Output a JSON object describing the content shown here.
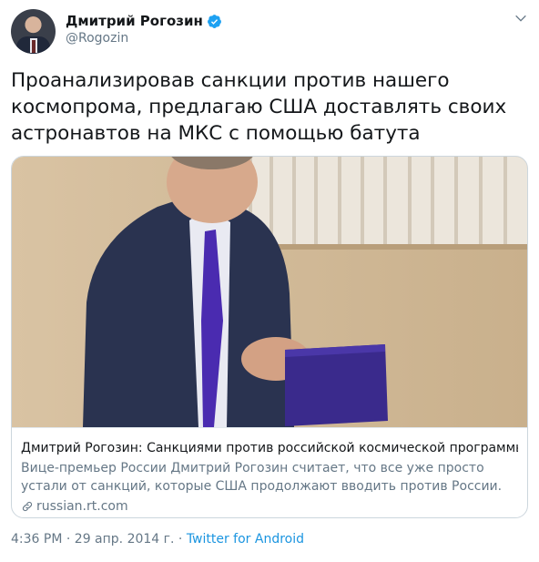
{
  "author": {
    "display_name": "Дмитрий Рогозин",
    "handle": "@Rogozin",
    "verified": true
  },
  "tweet": {
    "text": "Проанализировав санкции против нашего космопрома, предлагаю США доставлять своих астронавтов на МКС с помощью батута"
  },
  "card": {
    "title": "Дмитрий Рогозин: Санкциями против российской космической программы ...",
    "description": "Вице-премьер России Дмитрий Рогозин считает, что все уже просто устали от санкций, которые США продолжают вводить против России. Он недоумевае...",
    "domain": "russian.rt.com"
  },
  "meta": {
    "time": "4:36 PM",
    "separator1": " · ",
    "date": "29 апр. 2014 г.",
    "separator2": " · ",
    "source": "Twitter for Android"
  },
  "colors": {
    "primary_text": "#14171a",
    "secondary_text": "#657786",
    "link": "#1b95e0",
    "verified_badge": "#1da1f2",
    "card_border": "#ccd6dd"
  },
  "icons": [
    "verified-badge-icon",
    "chevron-down-icon",
    "link-icon"
  ]
}
